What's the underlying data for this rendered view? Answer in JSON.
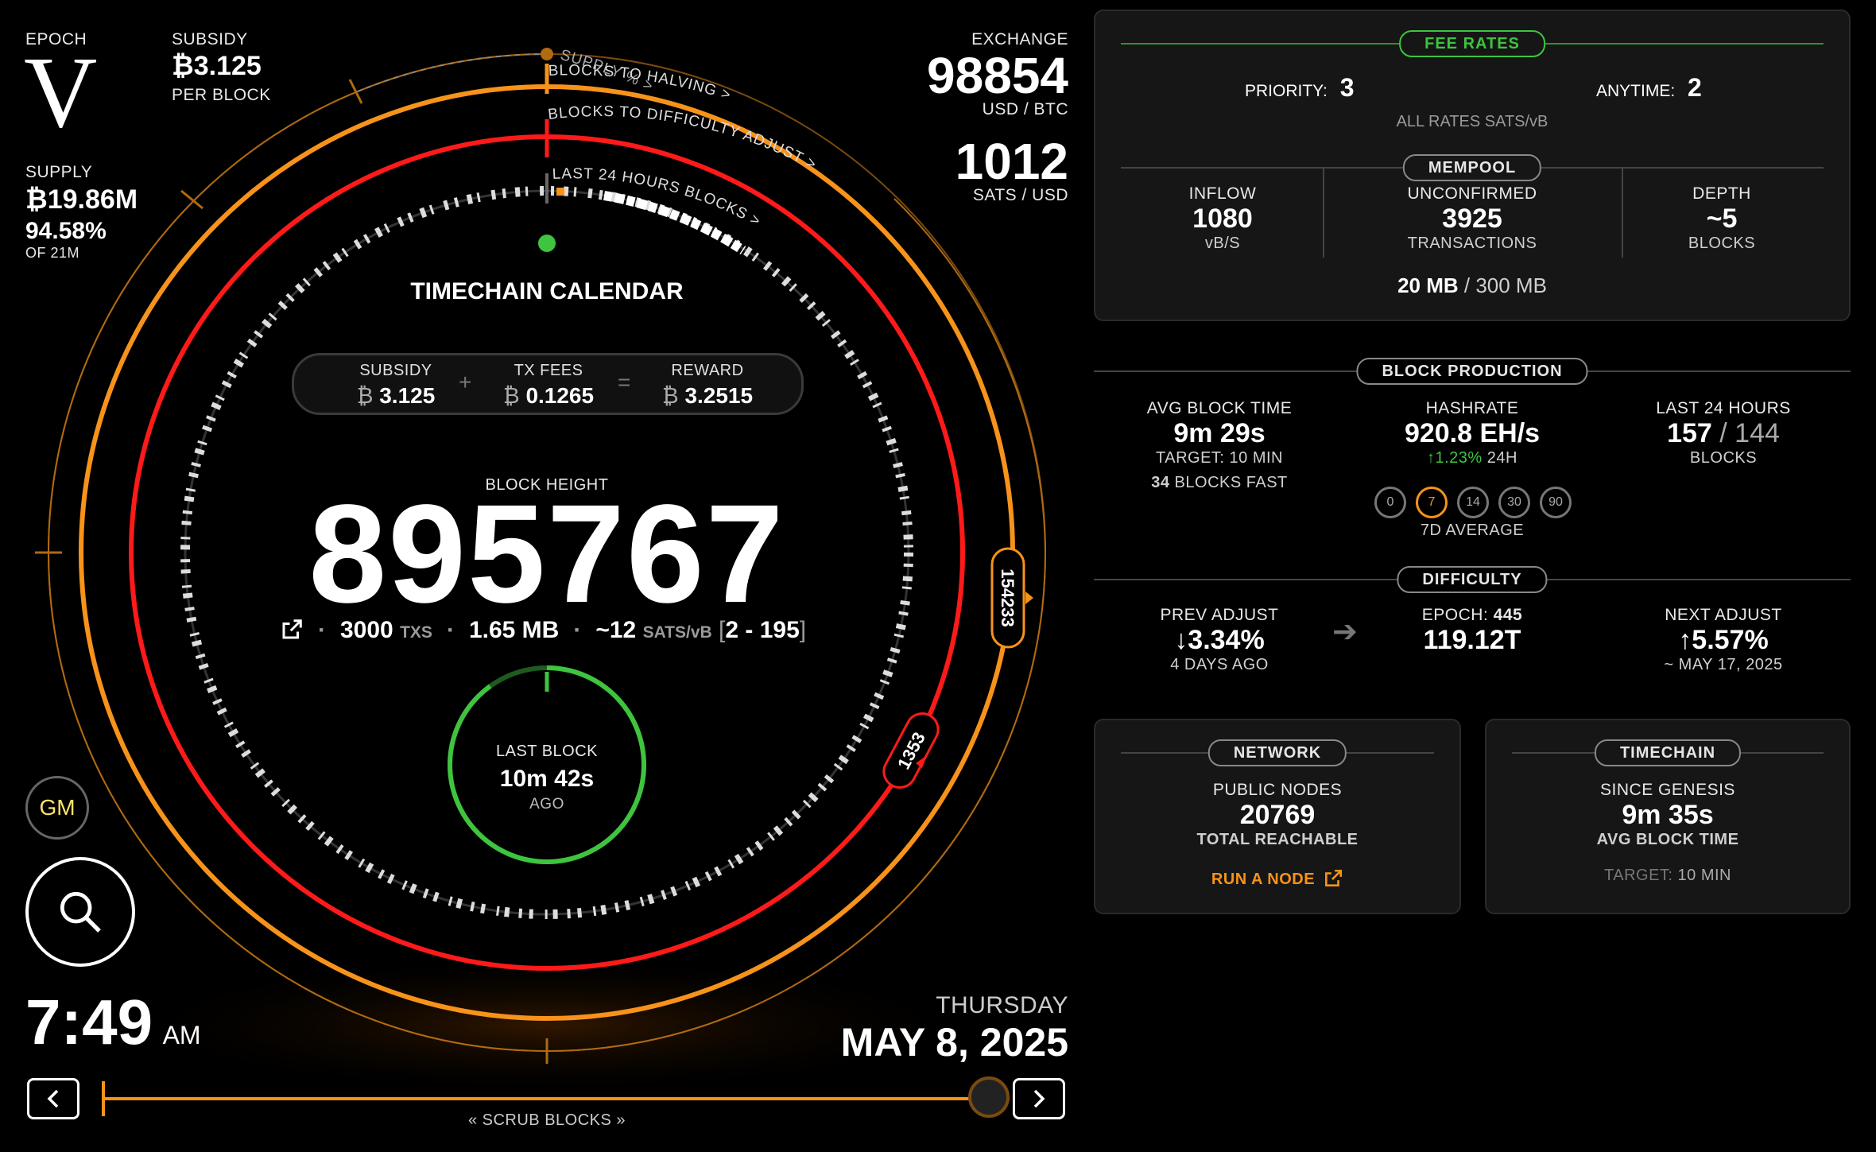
{
  "top_left": {
    "epoch_label": "EPOCH",
    "epoch_value": "V",
    "subsidy_label": "SUBSIDY",
    "subsidy_value": "₿3.125",
    "subsidy_unit": "PER BLOCK",
    "supply_label": "SUPPLY",
    "supply_value": "₿19.86M",
    "supply_pct": "94.58%",
    "supply_of": "OF 21M"
  },
  "exchange": {
    "label": "EXCHANGE",
    "price": "98854",
    "price_unit": "USD / BTC",
    "sats": "1012",
    "sats_unit": "SATS / USD"
  },
  "dial": {
    "supply_arc_label": "SUPPLY % >",
    "halving_label": "BLOCKS TO HALVING >",
    "difficulty_label": "BLOCKS TO DIFFICULTY ADJUST >",
    "last24_label": "LAST 24 HOURS BLOCKS >",
    "title": "TIMECHAIN CALENDAR",
    "halving_badge": "154233",
    "difficulty_badge": "1353",
    "supply_pct": 94.58,
    "halving_progress": 0.265,
    "difficulty_progress": 0.329
  },
  "reward": {
    "subsidy_label": "SUBSIDY",
    "subsidy_value": "3.125",
    "fees_label": "TX FEES",
    "fees_value": "0.1265",
    "reward_label": "REWARD",
    "reward_value": "3.2515",
    "plus": "+",
    "equals": "=",
    "btc_symbol": "₿"
  },
  "block": {
    "height_label": "BLOCK HEIGHT",
    "height": "895767",
    "txs": "3000",
    "txs_unit": "TXS",
    "size": "1.65 MB",
    "fee": "~12",
    "fee_unit": "SATS/vB",
    "range": "2 - 195",
    "dot": "·"
  },
  "last_block": {
    "label": "LAST BLOCK",
    "value": "10m 42s",
    "ago": "AGO"
  },
  "gm_label": "GM",
  "time": {
    "clock": "7:49",
    "ampm": "AM",
    "weekday": "THURSDAY",
    "date": "MAY 8, 2025"
  },
  "scrub": {
    "label": "SCRUB BLOCKS"
  },
  "fee_rates": {
    "title": "FEE RATES",
    "priority_label": "PRIORITY:",
    "priority_value": "3",
    "anytime_label": "ANYTIME:",
    "anytime_value": "2",
    "note": "ALL RATES SATS/vB"
  },
  "mempool": {
    "title": "MEMPOOL",
    "inflow_label": "INFLOW",
    "inflow_value": "1080",
    "inflow_unit": "vB/S",
    "unconfirmed_label": "UNCONFIRMED",
    "unconfirmed_value": "3925",
    "unconfirmed_unit": "TRANSACTIONS",
    "depth_label": "DEPTH",
    "depth_value": "~5",
    "depth_unit": "BLOCKS",
    "size_used": "20 MB",
    "size_total": "/ 300 MB"
  },
  "block_production": {
    "title": "BLOCK PRODUCTION",
    "avg_label": "AVG BLOCK TIME",
    "avg_value": "9m 29s",
    "avg_target": "TARGET: 10 MIN",
    "blocks_fast_count": "34",
    "blocks_fast_label": "BLOCKS FAST",
    "hash_label": "HASHRATE",
    "hash_value": "920.8 EH/s",
    "hash_change": "1.23%",
    "hash_period": "24H",
    "avg_options": [
      "0",
      "7",
      "14",
      "30",
      "90"
    ],
    "avg_selected": "7",
    "avg_caption": "7D AVERAGE",
    "last24_label": "LAST 24 HOURS",
    "last24_value": "157",
    "last24_target": "/ 144",
    "last24_unit": "BLOCKS"
  },
  "difficulty": {
    "title": "DIFFICULTY",
    "prev_label": "PREV ADJUST",
    "prev_value": "3.34%",
    "prev_when": "4 DAYS AGO",
    "epoch_label": "EPOCH:",
    "epoch_value": "445",
    "current": "119.12T",
    "next_label": "NEXT ADJUST",
    "next_value": "5.57%",
    "next_when": "~ MAY 17, 2025"
  },
  "network": {
    "title": "NETWORK",
    "nodes_label": "PUBLIC NODES",
    "nodes_value": "20769",
    "nodes_unit": "TOTAL REACHABLE",
    "run_node": "RUN A NODE"
  },
  "timechain": {
    "title": "TIMECHAIN",
    "since_label": "SINCE GENESIS",
    "since_value": "9m 35s",
    "since_unit": "AVG BLOCK TIME",
    "target_label": "TARGET:",
    "target_value": "10 MIN"
  },
  "colors": {
    "orange": "#f7931a",
    "red": "#ff1a1a",
    "green": "#3ec43e",
    "panel": "#161616"
  }
}
